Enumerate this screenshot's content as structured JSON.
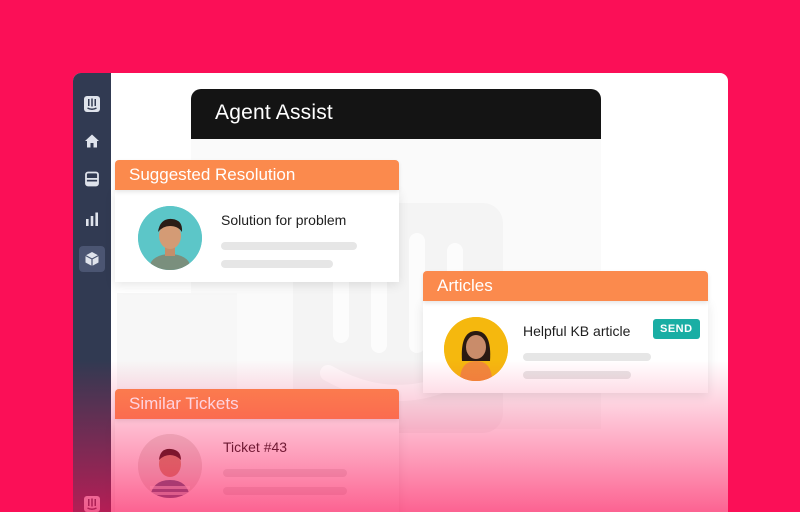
{
  "colors": {
    "background": "#fb0f57",
    "sidebar": "#313a52",
    "header_dark": "#141414",
    "accent_orange": "#fb8a4d",
    "send_teal": "#1aaea4"
  },
  "sidebar": {
    "items": [
      {
        "icon": "intercom-logo-icon"
      },
      {
        "icon": "home-icon"
      },
      {
        "icon": "inbox-icon"
      },
      {
        "icon": "bar-chart-icon"
      },
      {
        "icon": "cube-icon",
        "active": true
      },
      {
        "icon": "intercom-logo-icon"
      }
    ]
  },
  "agent_assist": {
    "title": "Agent Assist"
  },
  "suggested_resolution": {
    "header": "Suggested Resolution",
    "item_title": "Solution for problem"
  },
  "articles": {
    "header": "Articles",
    "item_title": "Helpful KB article",
    "action_label": "SEND"
  },
  "similar_tickets": {
    "header": "Similar Tickets",
    "item_title": "Ticket #43"
  }
}
